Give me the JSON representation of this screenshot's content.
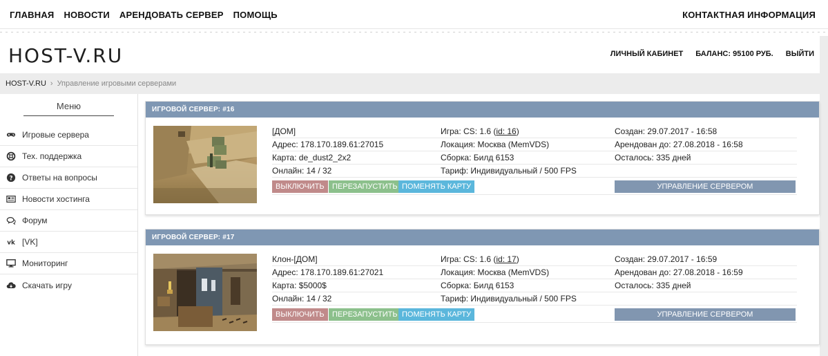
{
  "topnav": {
    "items": [
      "ГЛАВНАЯ",
      "НОВОСТИ",
      "АРЕНДОВАТЬ СЕРВЕР",
      "ПОМОЩЬ"
    ],
    "contact": "КОНТАКТНАЯ ИНФОРМАЦИЯ"
  },
  "header": {
    "logo": "HOST-V.RU",
    "cabinet": "ЛИЧНЫЙ КАБИНЕТ",
    "balance": "БАЛАНС: 95100 РУБ.",
    "logout": "ВЫЙТИ"
  },
  "breadcrumb": {
    "home": "HOST-V.RU",
    "separator": "›",
    "current": "Управление игровыми серверами"
  },
  "sidebar": {
    "title": "Меню",
    "items": [
      {
        "label": "Игровые сервера",
        "icon": "gamepad-icon"
      },
      {
        "label": "Тех. поддержка",
        "icon": "lifebuoy-icon"
      },
      {
        "label": "Ответы на вопросы",
        "icon": "question-icon"
      },
      {
        "label": "Новости хостинга",
        "icon": "newspaper-icon"
      },
      {
        "label": "Форум",
        "icon": "chat-icon"
      },
      {
        "label": "[VK]",
        "icon": "vk-icon"
      },
      {
        "label": "Мониторинг",
        "icon": "monitor-icon"
      },
      {
        "label": "Скачать игру",
        "icon": "cloud-download-icon"
      }
    ]
  },
  "servers": [
    {
      "title": "ИГРОВОЙ СЕРВЕР: #16",
      "name": "[ДОМ]",
      "address": "Адрес: 178.170.189.61:27015",
      "map": "Карта: de_dust2_2x2",
      "online": "Онлайн: 14 / 32",
      "game_prefix": "Игра: CS: 1.6 (",
      "game_id": "id: 16",
      "game_suffix": ")",
      "location": "Локация: Москва (MemVDS)",
      "build": "Сборка: Билд 6153",
      "tariff": "Тариф: Индивидуальный / 500 FPS",
      "created": "Создан: 29.07.2017 - 16:58",
      "rented_until": "Арендован до: 27.08.2018 - 16:58",
      "remaining": "Осталось: 335 дней",
      "buttons": {
        "off": "ВЫКЛЮЧИТЬ",
        "restart": "ПЕРЕЗАПУСТИТЬ",
        "change_map": "ПОМЕНЯТЬ КАРТУ",
        "manage": "УПРАВЛЕНИЕ СЕРВЕРОМ"
      }
    },
    {
      "title": "ИГРОВОЙ СЕРВЕР: #17",
      "name": "Клон-[ДОМ]",
      "address": "Адрес: 178.170.189.61:27021",
      "map": "Карта: $5000$",
      "online": "Онлайн: 14 / 32",
      "game_prefix": "Игра: CS: 1.6 (",
      "game_id": "id: 17",
      "game_suffix": ")",
      "location": "Локация: Москва (MemVDS)",
      "build": "Сборка: Билд 6153",
      "tariff": "Тариф: Индивидуальный / 500 FPS",
      "created": "Создан: 29.07.2017 - 16:59",
      "rented_until": "Арендован до: 27.08.2018 - 16:59",
      "remaining": "Осталось: 335 дней",
      "buttons": {
        "off": "ВЫКЛЮЧИТЬ",
        "restart": "ПЕРЕЗАПУСТИТЬ",
        "change_map": "ПОМЕНЯТЬ КАРТУ",
        "manage": "УПРАВЛЕНИЕ СЕРВЕРОМ"
      }
    }
  ],
  "colors": {
    "panel_header": "#7f97b3",
    "button_off": "#c08a8a",
    "button_restart": "#8cc08c",
    "button_map": "#5bb7dc",
    "button_manage": "#8196b0"
  }
}
